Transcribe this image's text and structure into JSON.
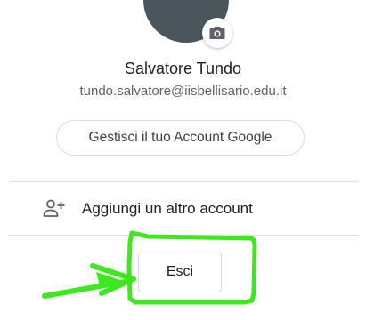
{
  "account": {
    "name": "Salvatore Tundo",
    "email": "tundo.salvatore@iisbellisario.edu.it"
  },
  "actions": {
    "manage_account_label": "Gestisci il tuo Account Google",
    "add_account_label": "Aggiungi un altro account",
    "sign_out_label": "Esci"
  },
  "icons": {
    "avatar_badge": "camera-icon",
    "add_account": "person-add-icon",
    "annotation": "arrow-icon"
  },
  "colors": {
    "annotation": "#3ee81e",
    "avatar": "#4a555c",
    "border": "#dadce0",
    "secondary_text": "#5f6368"
  }
}
